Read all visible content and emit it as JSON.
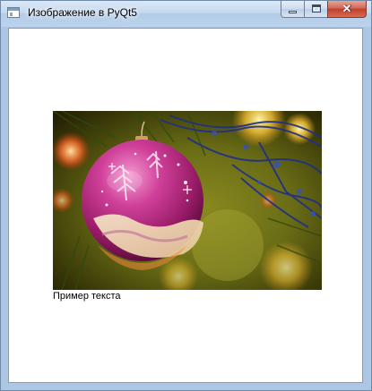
{
  "window": {
    "title": "Изображение в PyQt5",
    "controls": {
      "minimize_icon": "minimize-icon",
      "maximize_icon": "maximize-icon",
      "close_icon": "close-icon",
      "close_glyph": "✕"
    }
  },
  "content": {
    "image_subject": "christmas-ornament-photo",
    "label": "Пример текста"
  },
  "colors": {
    "ornament": "#b2277e",
    "ornament_highlight": "#e36bb5",
    "tinsel": "#2b3a8f",
    "foliage": "#5a6d18",
    "glow": "#f5c744"
  }
}
